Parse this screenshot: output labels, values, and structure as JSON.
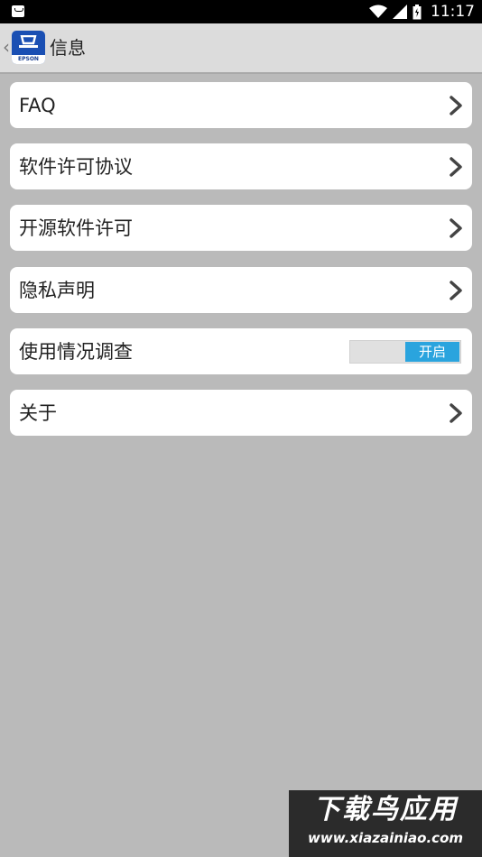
{
  "status_bar": {
    "time": "11:17"
  },
  "app_bar": {
    "back": "‹",
    "title": "信息",
    "logo_text": "EPSON"
  },
  "rows": [
    {
      "label": "FAQ",
      "type": "link"
    },
    {
      "label": "软件许可协议",
      "type": "link"
    },
    {
      "label": "开源软件许可",
      "type": "link"
    },
    {
      "label": "隐私声明",
      "type": "link"
    },
    {
      "label": "使用情况调查",
      "type": "toggle",
      "toggle_label": "开启",
      "toggle_on": true
    },
    {
      "label": "关于",
      "type": "link"
    }
  ],
  "watermark": {
    "title": "下载鸟应用",
    "url": "www.xiazainiao.com"
  },
  "colors": {
    "background": "#bababa",
    "accent": "#2aa4de",
    "app_bar": "#dcdcdc",
    "logo": "#1a4fb3"
  }
}
